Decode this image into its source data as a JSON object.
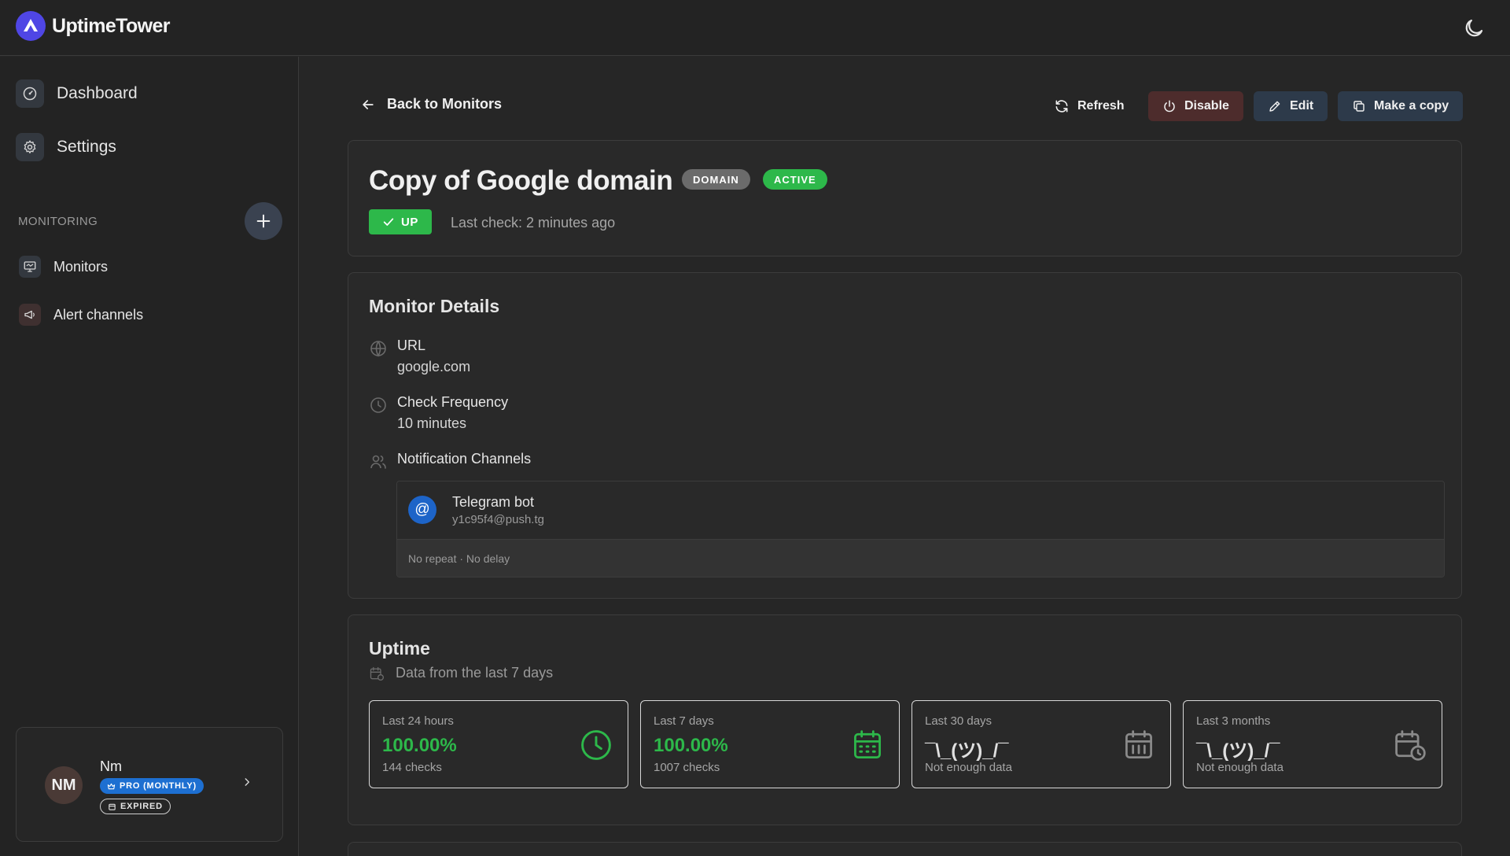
{
  "app": {
    "name": "UptimeTower"
  },
  "sidebar": {
    "nav": [
      {
        "label": "Dashboard"
      },
      {
        "label": "Settings"
      }
    ],
    "section_title": "MONITORING",
    "monitoring_items": [
      {
        "label": "Monitors"
      },
      {
        "label": "Alert channels"
      }
    ],
    "user": {
      "initials": "NM",
      "name": "Nm",
      "plan": "PRO (MONTHLY)",
      "plan_status": "EXPIRED"
    }
  },
  "header": {
    "back_label": "Back to Monitors",
    "actions": {
      "refresh": "Refresh",
      "disable": "Disable",
      "edit": "Edit",
      "copy": "Make a copy"
    }
  },
  "monitor": {
    "title": "Copy of Google domain",
    "type_badge": "DOMAIN",
    "state_badge": "ACTIVE",
    "status": "UP",
    "last_check": "Last check: 2 minutes ago"
  },
  "details": {
    "heading": "Monitor Details",
    "url_label": "URL",
    "url_value": "google.com",
    "frequency_label": "Check Frequency",
    "frequency_value": "10 minutes",
    "channels_label": "Notification Channels",
    "channel": {
      "name": "Telegram bot",
      "address": "y1c95f4@push.tg",
      "meta": "No repeat · No delay"
    }
  },
  "uptime": {
    "heading": "Uptime",
    "subtitle": "Data from the last 7 days",
    "stats": [
      {
        "label": "Last 24 hours",
        "value": "100.00%",
        "sub": "144 checks",
        "icon": "clock-icon"
      },
      {
        "label": "Last 7 days",
        "value": "100.00%",
        "sub": "1007 checks",
        "icon": "calendar-days-icon"
      },
      {
        "label": "Last 30 days",
        "value": "¯\\_(ツ)_/¯",
        "sub": "Not enough data",
        "icon": "calendar-range-icon"
      },
      {
        "label": "Last 3 months",
        "value": "¯\\_(ツ)_/¯",
        "sub": "Not enough data",
        "icon": "calendar-clock-icon"
      }
    ]
  },
  "colors": {
    "accent_green": "#2db84a",
    "brand_indigo": "#4f46e5",
    "pro_badge_blue": "#1d6fd1",
    "disable_button": "#4d2c2c"
  }
}
